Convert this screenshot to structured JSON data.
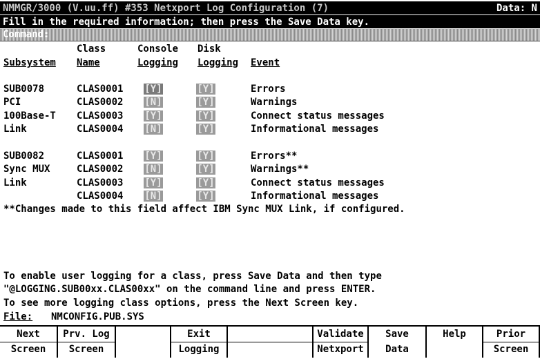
{
  "header": {
    "title": "NMMGR/3000 (V.uu.ff) #353 Netxport Log Configuration (7)",
    "data_flag": "Data: N",
    "instruction": "Fill in the required information; then press the Save Data key.",
    "command_label": "Command:"
  },
  "columns": {
    "subsystem": "Subsystem",
    "class_line1": "Class",
    "class_line2": "Name",
    "console_line1": "Console",
    "console_line2": "Logging",
    "disk_line1": "Disk",
    "disk_line2": "Logging",
    "event": "Event"
  },
  "rows": [
    {
      "subsystem": "SUB0078",
      "class": "CLAS0001",
      "console": "[Y]",
      "disk": "[Y]",
      "event": "Errors"
    },
    {
      "subsystem": "PCI",
      "class": "CLAS0002",
      "console": "[N]",
      "disk": "[Y]",
      "event": "Warnings"
    },
    {
      "subsystem": "100Base-T",
      "class": "CLAS0003",
      "console": "[Y]",
      "disk": "[Y]",
      "event": "Connect status messages"
    },
    {
      "subsystem": "Link",
      "class": "CLAS0004",
      "console": "[N]",
      "disk": "[Y]",
      "event": "Informational messages"
    },
    {
      "subsystem": "SUB0082",
      "class": "CLAS0001",
      "console": "[Y]",
      "disk": "[Y]",
      "event": "Errors**"
    },
    {
      "subsystem": "Sync MUX",
      "class": "CLAS0002",
      "console": "[N]",
      "disk": "[Y]",
      "event": "Warnings**"
    },
    {
      "subsystem": "Link",
      "class": "CLAS0003",
      "console": "[Y]",
      "disk": "[Y]",
      "event": "Connect status messages"
    },
    {
      "subsystem": "",
      "class": "CLAS0004",
      "console": "[N]",
      "disk": "[Y]",
      "event": "Informational messages"
    }
  ],
  "footnote": "**Changes made to this field affect IBM Sync MUX Link, if configured.",
  "help_lines": [
    "To enable user logging for a class, press Save Data and then type",
    "\"@LOGGING.SUB00xx.CLAS00xx\" on the command line and press ENTER.",
    "To see more logging class options, press the Next Screen key."
  ],
  "file": {
    "label": "File:",
    "value": "NMCONFIG.PUB.SYS"
  },
  "fkeys": [
    {
      "line1": "Next",
      "line2": "Screen"
    },
    {
      "line1": "Prv. Log",
      "line2": "Screen"
    },
    {
      "line1": "",
      "line2": ""
    },
    {
      "line1": "Exit",
      "line2": "Logging"
    },
    {
      "line1": "",
      "line2": ""
    },
    {
      "line1": "Validate",
      "line2": "Netxport"
    },
    {
      "line1": "Save",
      "line2": "Data"
    },
    {
      "line1": "Help",
      "line2": ""
    },
    {
      "line1": "Prior",
      "line2": "Screen"
    }
  ]
}
